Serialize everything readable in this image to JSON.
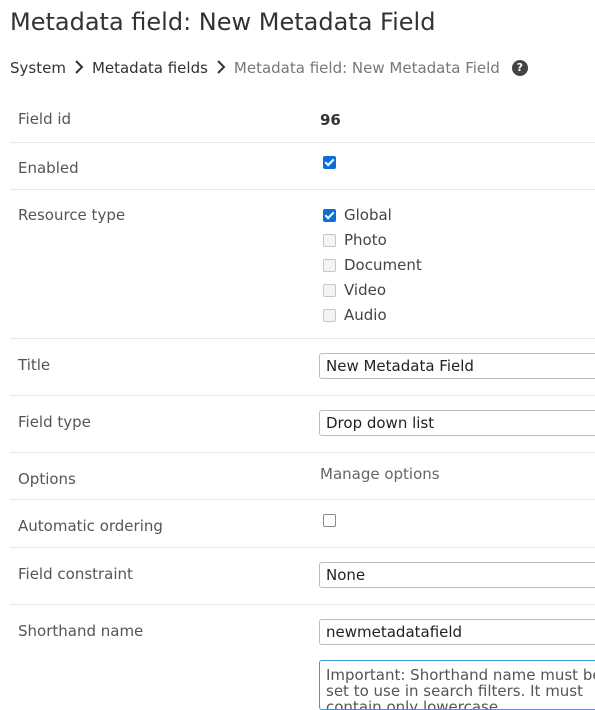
{
  "page": {
    "title": "Metadata field: New Metadata Field",
    "breadcrumbs": [
      "System",
      "Metadata fields",
      "Metadata field: New Metadata Field"
    ],
    "help_icon": "?"
  },
  "form": {
    "field_id": {
      "label": "Field id",
      "value": "96"
    },
    "enabled": {
      "label": "Enabled",
      "checked": true
    },
    "resource_type": {
      "label": "Resource type",
      "options": [
        {
          "label": "Global",
          "checked": true,
          "disabled": false
        },
        {
          "label": "Photo",
          "checked": false,
          "disabled": true
        },
        {
          "label": "Document",
          "checked": false,
          "disabled": true
        },
        {
          "label": "Video",
          "checked": false,
          "disabled": true
        },
        {
          "label": "Audio",
          "checked": false,
          "disabled": true
        }
      ]
    },
    "title": {
      "label": "Title",
      "value": "New Metadata Field"
    },
    "field_type": {
      "label": "Field type",
      "value": "Drop down list"
    },
    "options": {
      "label": "Options",
      "link": "Manage options"
    },
    "automatic_ordering": {
      "label": "Automatic ordering",
      "checked": false
    },
    "field_constraint": {
      "label": "Field constraint",
      "value": "None"
    },
    "shorthand_name": {
      "label": "Shorthand name",
      "value": "newmetadatafield",
      "note": "Important: Shorthand name must be set to use in search filters. It must contain only lowercase"
    }
  },
  "colors": {
    "checkbox_accent": "#0b6fd6",
    "note_border": "#3a9bd9"
  }
}
